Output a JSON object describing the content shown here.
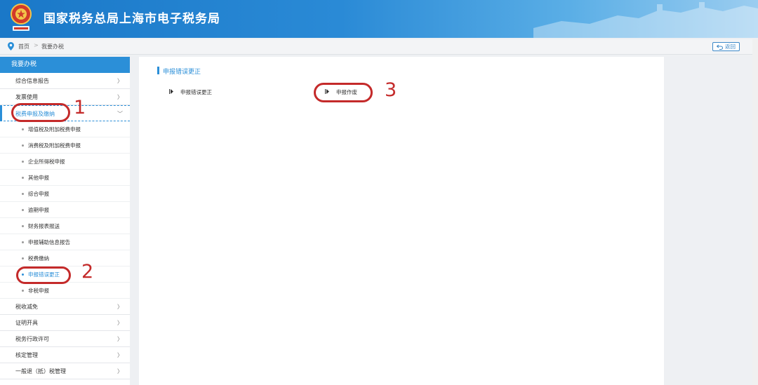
{
  "header": {
    "title": "国家税务总局上海市电子税务局"
  },
  "breadcrumb": {
    "home": "首页",
    "separator": ">",
    "current": "我要办税",
    "back_label": "返回"
  },
  "sidebar": {
    "heading": "我要办税",
    "items_top": [
      {
        "label": "综合信息报告",
        "chevron": "〉"
      },
      {
        "label": "发票使用",
        "chevron": "〉"
      }
    ],
    "active": {
      "label": "税费申报及缴纳",
      "chevron": "﹀"
    },
    "subitems": [
      "增值税及附加税费申报",
      "消费税及附加税费申报",
      "企业所得税申报",
      "其他申报",
      "综合申报",
      "逾期申报",
      "财务报表报送",
      "申报辅助信息报告",
      "税费缴纳",
      "申报错误更正",
      "非税申报"
    ],
    "current_subitem_index": 9,
    "items_bottom": [
      {
        "label": "税收减免",
        "chevron": "〉"
      },
      {
        "label": "证明开具",
        "chevron": "〉"
      },
      {
        "label": "税务行政许可",
        "chevron": "〉"
      },
      {
        "label": "核定管理",
        "chevron": "〉"
      },
      {
        "label": "一般退（抵）税管理",
        "chevron": "〉"
      }
    ]
  },
  "main": {
    "title": "申报错误更正",
    "links": [
      "申报错误更正",
      "申报作废"
    ]
  },
  "annotations": {
    "n1": "1",
    "n2": "2",
    "n3": "3",
    "color": "#c42a2a"
  },
  "colors": {
    "accent": "#2b8fd8"
  }
}
